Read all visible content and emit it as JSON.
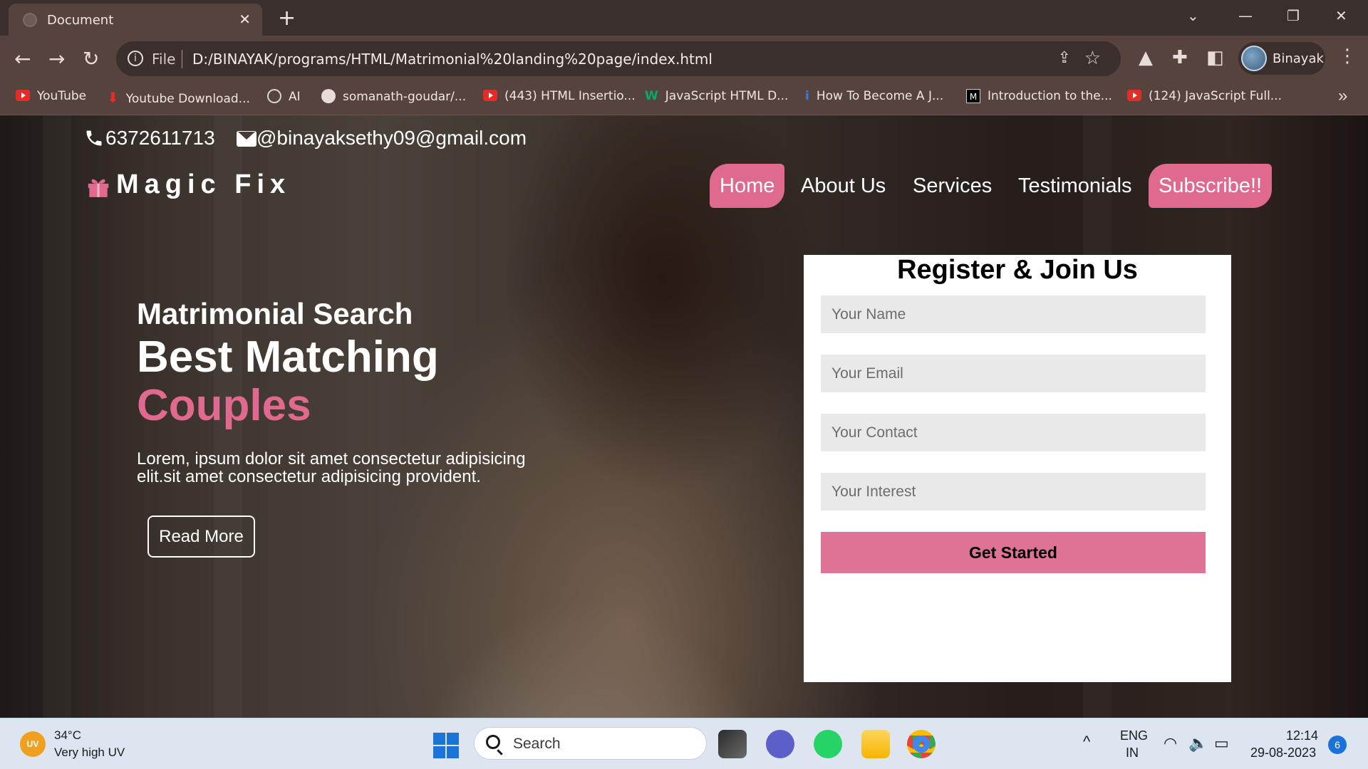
{
  "browser": {
    "tab_title": "Document",
    "tab_close": "✕",
    "new_tab": "+",
    "address_scheme": "File",
    "url": "D:/BINAYAK/programs/HTML/Matrimonial%20landing%20page/index.html",
    "profile_name": "Binayak",
    "bookmarks": [
      {
        "label": "YouTube",
        "icon": "youtube-icon"
      },
      {
        "label": "Youtube Download...",
        "icon": "download-icon"
      },
      {
        "label": "AI",
        "icon": "openai-icon"
      },
      {
        "label": "somanath-goudar/...",
        "icon": "github-icon"
      },
      {
        "label": "(443) HTML Insertio...",
        "icon": "youtube-icon"
      },
      {
        "label": "JavaScript HTML D...",
        "icon": "w3schools-icon"
      },
      {
        "label": "How To Become A J...",
        "icon": "info-icon"
      },
      {
        "label": "Introduction to the...",
        "icon": "mdn-icon"
      },
      {
        "label": "(124) JavaScript Full...",
        "icon": "youtube-icon"
      }
    ],
    "bookmarks_more": "»"
  },
  "page": {
    "phone": "6372611713",
    "email": "@binayaksethy09@gmail.com",
    "logo": "Magic Fix",
    "nav": [
      "Home",
      "About Us",
      "Services",
      "Testimonials",
      "Subscribe!!"
    ],
    "hero": {
      "small": "Matrimonial Search",
      "big": "Best Matching",
      "pink": "Couples",
      "lorem_line1": "Lorem, ipsum dolor sit amet consectetur adipisicing",
      "lorem_line2": "elit.sit amet consectetur adipisicing provident.",
      "read_more": "Read More"
    },
    "form": {
      "title": "Register & Join Us",
      "name_placeholder": "Your Name",
      "email_placeholder": "Your Email",
      "contact_placeholder": "Your Contact",
      "interest_placeholder": "Your Interest",
      "submit": "Get Started"
    },
    "colors": {
      "accent": "#e0698f",
      "button": "#de7396"
    }
  },
  "taskbar": {
    "uv_badge": "UV",
    "temp": "34°C",
    "weather": "Very high UV",
    "search": "Search",
    "lang1": "ENG",
    "lang2": "IN",
    "time": "12:14",
    "date": "29-08-2023",
    "notifications": "6"
  }
}
